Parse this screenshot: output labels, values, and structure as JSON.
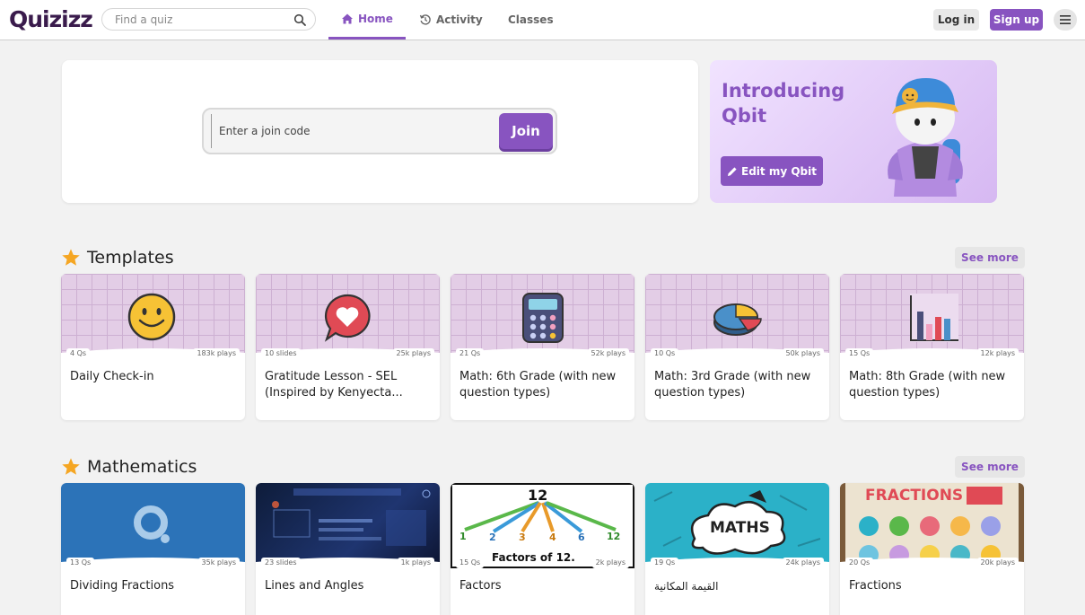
{
  "header": {
    "logo": "Quizizz",
    "search_placeholder": "Find a quiz",
    "tabs": [
      {
        "label": "Home",
        "icon": "home-icon",
        "active": true
      },
      {
        "label": "Activity",
        "icon": "history-icon",
        "active": false
      },
      {
        "label": "Classes",
        "icon": "",
        "active": false
      }
    ],
    "login_label": "Log in",
    "signup_label": "Sign up",
    "menu_icon": "hamburger-icon"
  },
  "join": {
    "placeholder": "Enter a join code",
    "button_label": "Join"
  },
  "qbit": {
    "title": "Introducing Qbit",
    "button_label": "Edit my Qbit",
    "button_icon": "pencil-icon"
  },
  "templates": {
    "title": "Templates",
    "see_more": "See more",
    "cards": [
      {
        "title": "Daily Check-in",
        "count": "4 Qs",
        "plays": "183k plays",
        "image": "smiley-face-icon"
      },
      {
        "title": "Gratitude Lesson - SEL (Inspired by Kenyecta...",
        "count": "10 slides",
        "plays": "25k plays",
        "image": "heart-speech-bubble-icon"
      },
      {
        "title": "Math: 6th Grade (with new question types)",
        "count": "21 Qs",
        "plays": "52k plays",
        "image": "calculator-icon"
      },
      {
        "title": "Math: 3rd Grade (with new question types)",
        "count": "10 Qs",
        "plays": "50k plays",
        "image": "pie-chart-icon"
      },
      {
        "title": "Math: 8th Grade (with new question types)",
        "count": "15 Qs",
        "plays": "12k plays",
        "image": "bar-chart-icon"
      }
    ]
  },
  "mathematics": {
    "title": "Mathematics",
    "see_more": "See more",
    "cards": [
      {
        "title": "Dividing Fractions",
        "count": "13 Qs",
        "plays": "35k plays",
        "image": "quizizz-q-logo"
      },
      {
        "title": "Lines and Angles",
        "count": "23 slides",
        "plays": "1k plays",
        "image": "dark-tech-screen"
      },
      {
        "title": "Factors",
        "count": "15 Qs",
        "plays": "2k plays",
        "image": "factors-of-12-diagram",
        "image_text": {
          "top": "12",
          "nums": [
            "1",
            "2",
            "3",
            "4",
            "6",
            "12"
          ],
          "caption": "Factors of 12."
        }
      },
      {
        "title": "القيمة المكانية",
        "count": "19 Qs",
        "plays": "24k plays",
        "image": "maths-cloud-doodle",
        "image_text": {
          "word": "MATHS"
        }
      },
      {
        "title": "Fractions",
        "count": "20 Qs",
        "plays": "20k plays",
        "image": "fractions-board",
        "image_text": {
          "word": "FRACTIONS"
        }
      }
    ]
  },
  "colors": {
    "brand": "#8854c0",
    "logo": "#3a1b4c",
    "background": "#f2f2f2"
  }
}
